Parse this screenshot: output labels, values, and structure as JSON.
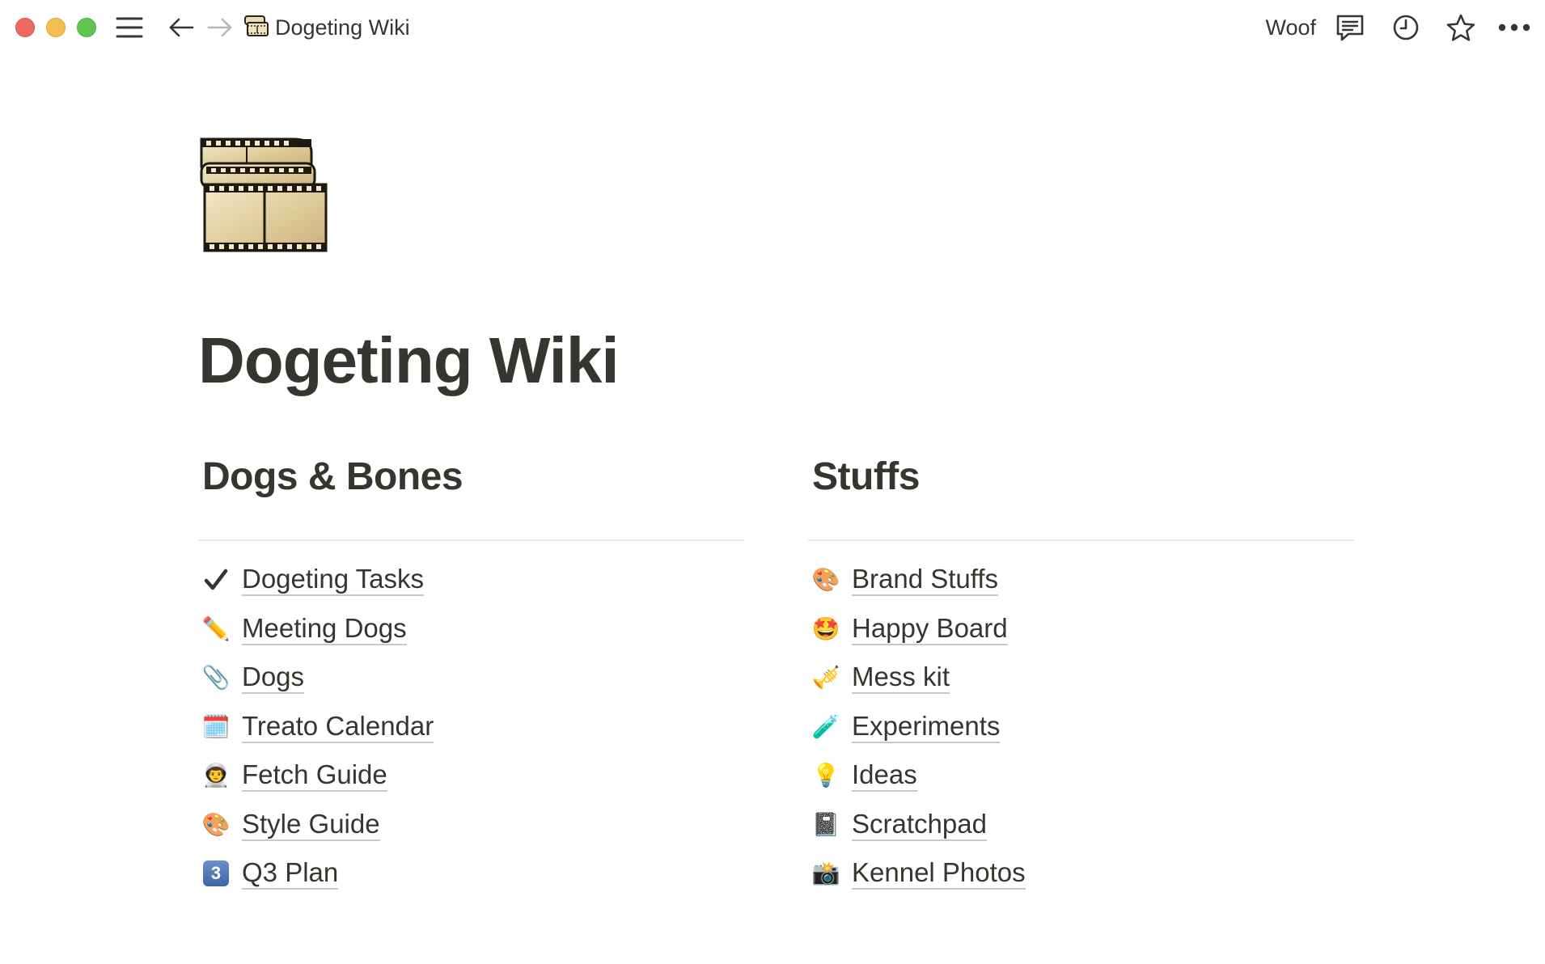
{
  "window": {
    "breadcrumb_icon": "film-frames-emoji",
    "breadcrumb_title": "Dogeting Wiki",
    "workspace_label": "Woof"
  },
  "icons": {
    "menu": "hamburger-menu-icon",
    "back": "arrow-left-icon",
    "forward": "arrow-right-icon",
    "comments": "comment-icon",
    "history": "clock-icon",
    "favorite": "star-icon",
    "more": "ellipsis-icon"
  },
  "page": {
    "icon": "film-frames",
    "title": "Dogeting Wiki"
  },
  "columns": [
    {
      "heading": "Dogs & Bones",
      "links": [
        {
          "emoji": "✔",
          "label": "Dogeting Tasks"
        },
        {
          "emoji": "✏️",
          "label": "Meeting Dogs"
        },
        {
          "emoji": "📎",
          "label": "Dogs"
        },
        {
          "emoji": "🗓️",
          "label": "Treato Calendar"
        },
        {
          "emoji": "👨‍🚀",
          "label": "Fetch Guide"
        },
        {
          "emoji": "🎨",
          "label": "Style Guide"
        },
        {
          "emoji": "3",
          "label": "Q3 Plan"
        }
      ]
    },
    {
      "heading": "Stuffs",
      "links": [
        {
          "emoji": "🎨",
          "label": "Brand Stuffs"
        },
        {
          "emoji": "🤩",
          "label": "Happy Board"
        },
        {
          "emoji": "🎺",
          "label": "Mess kit"
        },
        {
          "emoji": "🧪",
          "label": "Experiments"
        },
        {
          "emoji": "💡",
          "label": "Ideas"
        },
        {
          "emoji": "📓",
          "label": "Scratchpad"
        },
        {
          "emoji": "📸",
          "label": "Kennel Photos"
        }
      ]
    }
  ],
  "colors": {
    "text": "#37352f",
    "divider": "#e9e9e7",
    "traffic_red": "#ed6a5e",
    "traffic_yellow": "#f4bf4f",
    "traffic_green": "#61c554"
  }
}
